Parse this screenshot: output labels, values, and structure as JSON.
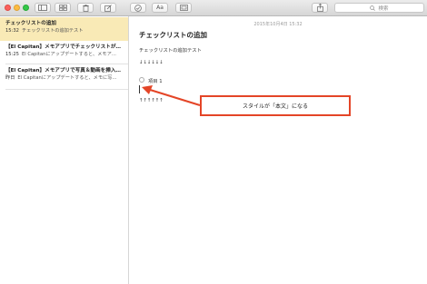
{
  "window": {
    "traffic_lights": {
      "close": "#fc605c",
      "minimize": "#fdbc40",
      "zoom": "#34c84a"
    }
  },
  "toolbar": {
    "buttons": [
      "sidebar-toggle",
      "attachments-browser",
      "delete",
      "new-note",
      "checklist",
      "format",
      "attachments"
    ],
    "share": "share",
    "search_placeholder": "検索"
  },
  "notes": [
    {
      "title": "チェックリストの追加",
      "time": "15:32",
      "preview": "チェックリストの追加テスト",
      "selected": true
    },
    {
      "title": "【El Capitan】メモアプリでチェックリストが…",
      "time": "15:25",
      "preview": "El Capitanにアップデートすると、メモア…",
      "selected": false
    },
    {
      "title": "【El Capitan】メモアプリで写真＆動画を挿入…",
      "time": "昨日",
      "preview": "El Capitanにアップデートすると、メモに写…",
      "selected": false
    }
  ],
  "editor": {
    "date": "2015年10月4日 15:32",
    "title": "チェックリストの追加",
    "body_line": "チェックリストの追加テスト",
    "down_arrows": "↓↓↓↓↓↓",
    "checklist_item": "項目 1",
    "up_arrows": "↑↑↑↑↑↑"
  },
  "annotation": {
    "text": "スタイルが「本文」になる",
    "color": "#e44527"
  }
}
